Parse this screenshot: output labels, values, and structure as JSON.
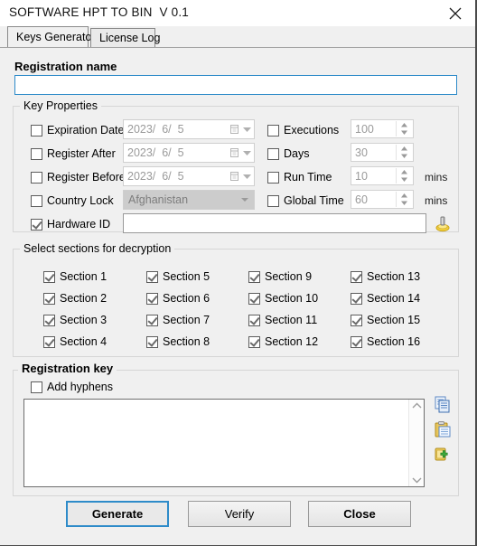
{
  "window": {
    "title": "SOFTWARE HPT TO BIN  V 0.1",
    "close_icon": "close-icon"
  },
  "tabs": [
    {
      "label": "Keys Generator",
      "active": true
    },
    {
      "label": "License Log",
      "active": false
    }
  ],
  "registration_name": {
    "caption": "Registration name",
    "value": "",
    "placeholder": ""
  },
  "key_properties": {
    "caption": "Key Properties",
    "left_rows": [
      {
        "label": "Expiration Date",
        "checked": false,
        "control": "date",
        "value": "2023/  6/  5"
      },
      {
        "label": "Register After",
        "checked": false,
        "control": "date",
        "value": "2023/  6/  5"
      },
      {
        "label": "Register Before",
        "checked": false,
        "control": "date",
        "value": "2023/  6/  5"
      },
      {
        "label": "Country Lock",
        "checked": false,
        "control": "combo",
        "value": "Afghanistan"
      },
      {
        "label": "Hardware ID",
        "checked": true,
        "control": "text",
        "value": ""
      }
    ],
    "right_rows": [
      {
        "label": "Executions",
        "checked": false,
        "value": "100",
        "unit": ""
      },
      {
        "label": "Days",
        "checked": false,
        "value": "30",
        "unit": ""
      },
      {
        "label": "Run Time",
        "checked": false,
        "value": "10",
        "unit": "mins"
      },
      {
        "label": "Global Time",
        "checked": false,
        "value": "60",
        "unit": "mins"
      }
    ],
    "hwid_icon": "hardware-id-icon"
  },
  "sections": {
    "caption": "Select sections for decryption",
    "items": [
      {
        "label": "Section 1",
        "checked": true
      },
      {
        "label": "Section 5",
        "checked": true
      },
      {
        "label": "Section 9",
        "checked": true
      },
      {
        "label": "Section 13",
        "checked": true
      },
      {
        "label": "Section 2",
        "checked": true
      },
      {
        "label": "Section 6",
        "checked": true
      },
      {
        "label": "Section 10",
        "checked": true
      },
      {
        "label": "Section 14",
        "checked": true
      },
      {
        "label": "Section 3",
        "checked": true
      },
      {
        "label": "Section 7",
        "checked": true
      },
      {
        "label": "Section 11",
        "checked": true
      },
      {
        "label": "Section 15",
        "checked": true
      },
      {
        "label": "Section 4",
        "checked": true
      },
      {
        "label": "Section 8",
        "checked": true
      },
      {
        "label": "Section 12",
        "checked": true
      },
      {
        "label": "Section 16",
        "checked": true
      }
    ]
  },
  "registration_key": {
    "caption": "Registration key",
    "add_hyphens_label": "Add hyphens",
    "add_hyphens_checked": false,
    "value": "",
    "tools": [
      {
        "name": "copy-icon"
      },
      {
        "name": "paste-icon"
      },
      {
        "name": "add-license-icon"
      }
    ]
  },
  "buttons": {
    "generate": "Generate",
    "verify": "Verify",
    "close": "Close"
  },
  "colors": {
    "accent": "#2e8bc9",
    "window_bg": "#f0f0f0",
    "field_bg": "#ffffff",
    "disabled_text": "#9a9a9a",
    "disabled_combo_bg": "#cccccc"
  }
}
